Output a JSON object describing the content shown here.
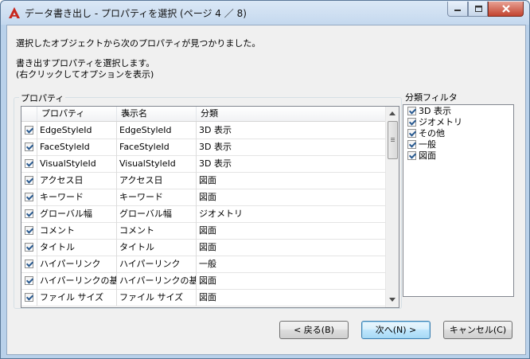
{
  "window": {
    "title": "データ書き出し - プロパティを選択 (ページ 4 ／ 8)",
    "icon": "autocad-a-icon",
    "controls": {
      "minimize": "minimize-icon",
      "maximize": "maximize-icon",
      "close": "close-icon"
    }
  },
  "messages": {
    "found": "選択したオブジェクトから次のプロパティが見つかりました。",
    "instruction": "書き出すプロパティを選択します。",
    "hint": "(右クリックしてオプションを表示)"
  },
  "properties_group": {
    "label": "プロパティ",
    "columns": [
      "プロパティ",
      "表示名",
      "分類"
    ],
    "sort_column": "プロパティ",
    "sort_direction": "ascending",
    "rows": [
      {
        "checked": true,
        "property": "EdgeStyleId",
        "display": "EdgeStyleId",
        "category": "3D 表示"
      },
      {
        "checked": true,
        "property": "FaceStyleId",
        "display": "FaceStyleId",
        "category": "3D 表示"
      },
      {
        "checked": true,
        "property": "VisualStyleId",
        "display": "VisualStyleId",
        "category": "3D 表示"
      },
      {
        "checked": true,
        "property": "アクセス日",
        "display": "アクセス日",
        "category": "図面"
      },
      {
        "checked": true,
        "property": "キーワード",
        "display": "キーワード",
        "category": "図面"
      },
      {
        "checked": true,
        "property": "グローバル幅",
        "display": "グローバル幅",
        "category": "ジオメトリ"
      },
      {
        "checked": true,
        "property": "コメント",
        "display": "コメント",
        "category": "図面"
      },
      {
        "checked": true,
        "property": "タイトル",
        "display": "タイトル",
        "category": "図面"
      },
      {
        "checked": true,
        "property": "ハイパーリンク",
        "display": "ハイパーリンク",
        "category": "一般"
      },
      {
        "checked": true,
        "property": "ハイパーリンクの基...",
        "display": "ハイパーリンクの基...",
        "category": "図面"
      },
      {
        "checked": true,
        "property": "ファイル サイズ",
        "display": "ファイル サイズ",
        "category": "図面"
      }
    ]
  },
  "filter_group": {
    "label": "分類フィルタ",
    "items": [
      {
        "label": "3D 表示",
        "checked": true
      },
      {
        "label": "ジオメトリ",
        "checked": true
      },
      {
        "label": "その他",
        "checked": true
      },
      {
        "label": "一般",
        "checked": true
      },
      {
        "label": "図面",
        "checked": true
      }
    ]
  },
  "buttons": {
    "back": "< 戻る(B)",
    "next": "次へ(N) >",
    "cancel": "キャンセル(C)"
  },
  "colors": {
    "accent_red": "#c8281e",
    "check_blue": "#2a5b91",
    "default_button_border": "#3c7fb1"
  }
}
